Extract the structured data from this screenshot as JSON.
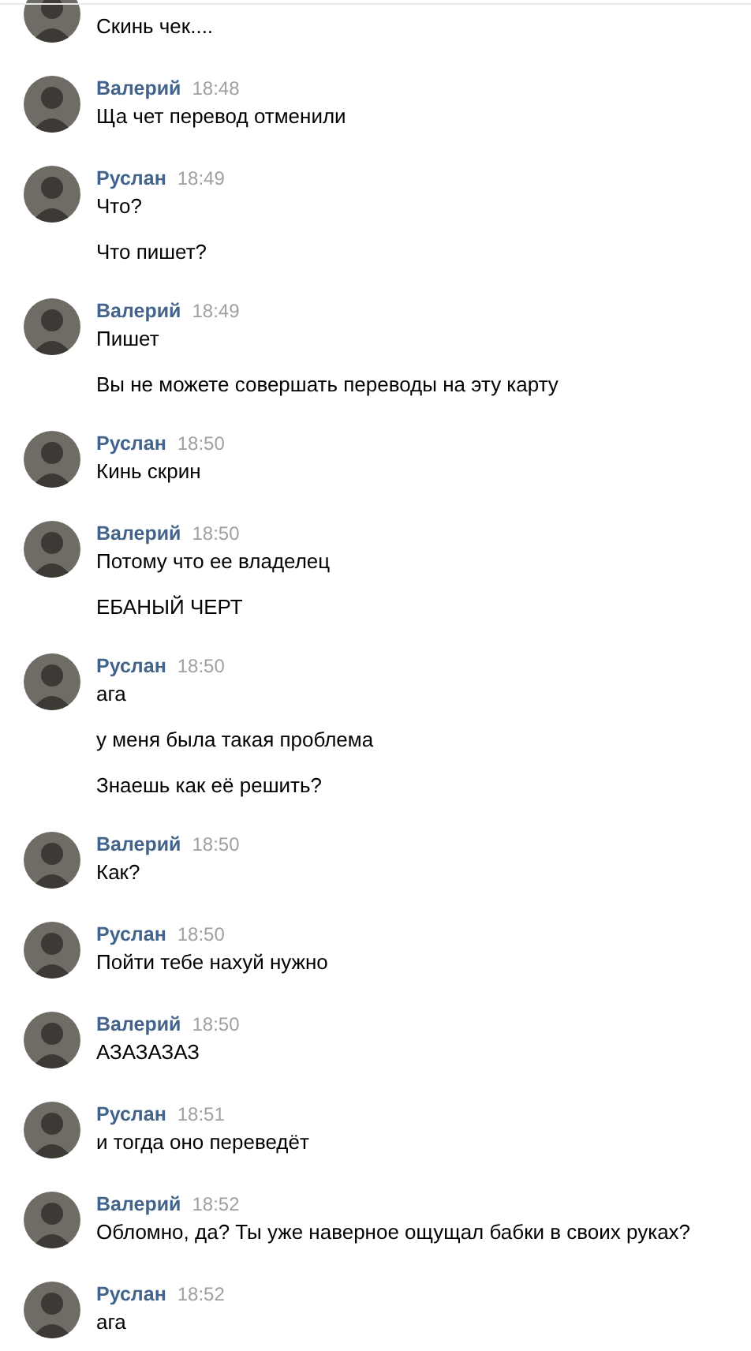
{
  "messages": [
    {
      "texts": [
        "Скинь чек...."
      ]
    },
    {
      "author": "Валерий",
      "time": "18:48",
      "texts": [
        "Ща чет перевод отменили"
      ]
    },
    {
      "author": "Руслан",
      "time": "18:49",
      "texts": [
        "Что?",
        "Что пишет?"
      ]
    },
    {
      "author": "Валерий",
      "time": "18:49",
      "texts": [
        "Пишет",
        "Вы не можете совершать переводы на эту карту"
      ]
    },
    {
      "author": "Руслан",
      "time": "18:50",
      "texts": [
        "Кинь скрин"
      ]
    },
    {
      "author": "Валерий",
      "time": "18:50",
      "texts": [
        "Потому что ее владелец",
        "ЕБАНЫЙ ЧЕРТ"
      ]
    },
    {
      "author": "Руслан",
      "time": "18:50",
      "texts": [
        "ага",
        "у меня была такая проблема",
        "Знаешь как её решить?"
      ]
    },
    {
      "author": "Валерий",
      "time": "18:50",
      "texts": [
        "Как?"
      ]
    },
    {
      "author": "Руслан",
      "time": "18:50",
      "texts": [
        "Пойти тебе нахуй нужно"
      ]
    },
    {
      "author": "Валерий",
      "time": "18:50",
      "texts": [
        "АЗАЗАЗАЗ"
      ]
    },
    {
      "author": "Руслан",
      "time": "18:51",
      "texts": [
        "и тогда оно переведёт"
      ]
    },
    {
      "author": "Валерий",
      "time": "18:52",
      "texts": [
        "Обломно, да? Ты уже наверное ощущал бабки в своих руках?"
      ]
    },
    {
      "author": "Руслан",
      "time": "18:52",
      "texts": [
        "ага"
      ]
    }
  ]
}
